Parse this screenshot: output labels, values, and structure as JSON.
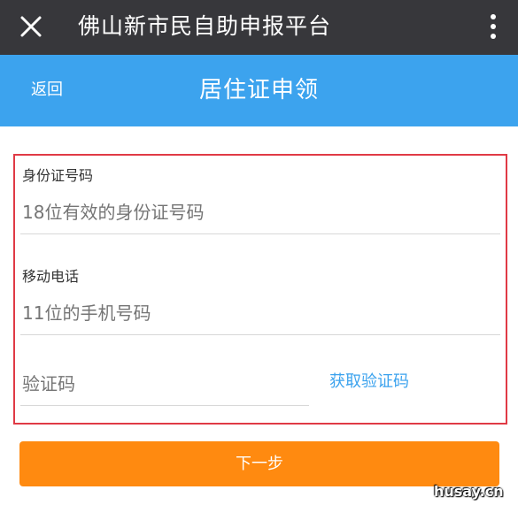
{
  "window": {
    "title": "佛山新市民自助申报平台",
    "close_icon": "close-icon",
    "more_icon": "more-vertical-icon"
  },
  "header": {
    "back_label": "返回",
    "title": "居住证申领"
  },
  "form": {
    "id_number": {
      "label": "身份证号码",
      "placeholder": "18位有效的身份证号码"
    },
    "mobile": {
      "label": "移动电话",
      "placeholder": "11位的手机号码"
    },
    "verification": {
      "placeholder": "验证码",
      "get_code_label": "获取验证码"
    }
  },
  "actions": {
    "next_label": "下一步"
  },
  "watermark": "husay.cn",
  "colors": {
    "topbar": "#37373b",
    "header": "#3ca3ee",
    "primary_button": "#ff8a10",
    "highlight_border": "#e03a45",
    "link": "#3ca3ee"
  }
}
